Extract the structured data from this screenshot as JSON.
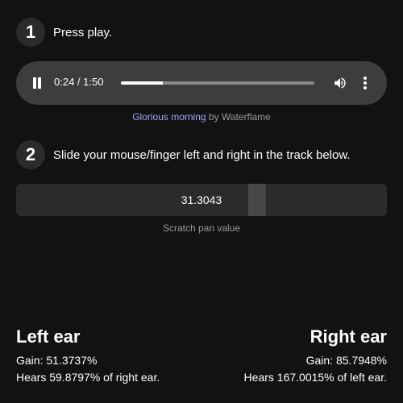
{
  "steps": [
    {
      "number": "1",
      "text": "Press play."
    },
    {
      "number": "2",
      "text": "Slide your mouse/finger left and right in the track below."
    }
  ],
  "player": {
    "time": "0:24 / 1:50",
    "progress_fraction": 0.2182,
    "play_icon": "pause-icon",
    "volume_icon": "volume-icon",
    "menu_icon": "more-vert-icon"
  },
  "credit": {
    "song": "Glorious morning",
    "by": " by ",
    "artist": "Waterflame"
  },
  "pan": {
    "value": "31.3043",
    "position_fraction": 0.65,
    "caption": "Scratch pan value"
  },
  "left_ear": {
    "title": "Left ear",
    "gain": "Gain: 51.3737%",
    "hears": "Hears 59.8797% of right ear."
  },
  "right_ear": {
    "title": "Right ear",
    "gain": "Gain: 85.7948%",
    "hears": "Hears 167.0015% of left ear."
  },
  "colors": {
    "background": "#121212",
    "link": "#a3a3ff"
  }
}
